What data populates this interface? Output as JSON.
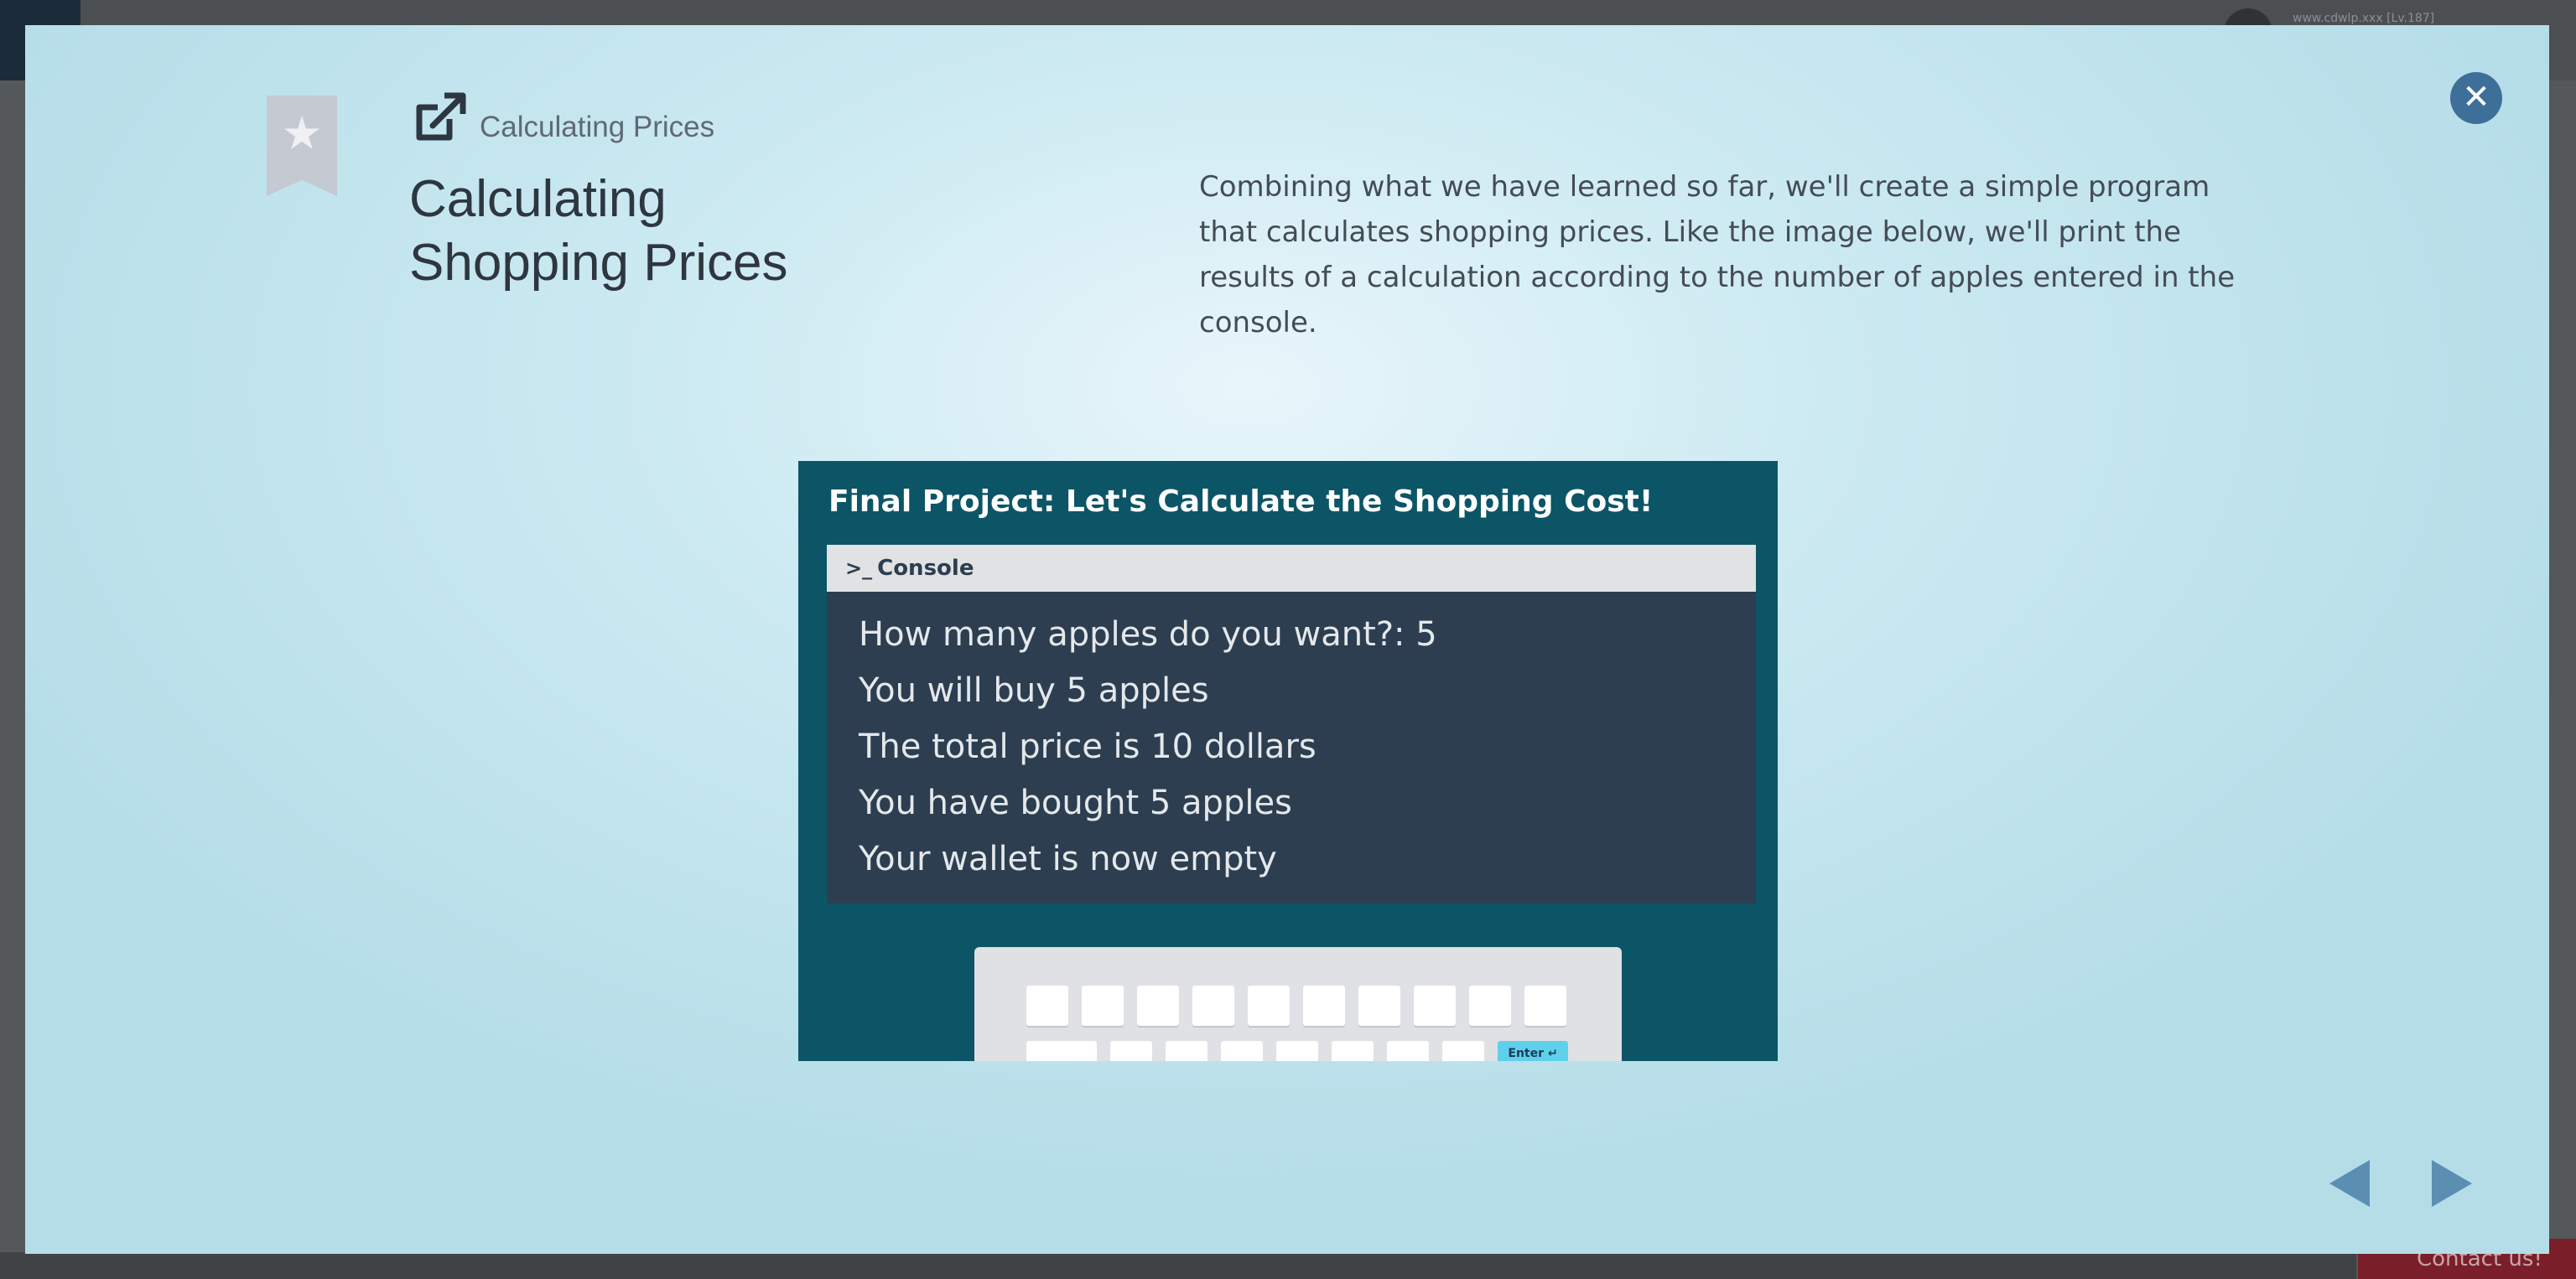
{
  "background": {
    "account_email": "www.cdwlp.xxx [Lv.187]",
    "contact_label": "Contact us!"
  },
  "lesson": {
    "breadcrumb": "Calculating Prices",
    "title": "Calculating Shopping Prices",
    "description": "Combining what we have learned so far, we'll create a simple program that calculates shopping prices. Like the image below, we'll print the results of a calculation according to the number of apples entered in the console."
  },
  "illustration": {
    "title": "Final Project: Let's Calculate the Shopping Cost!",
    "console_label": "Console",
    "console_lines": [
      "How many apples do you want?: 5",
      "You will buy 5 apples",
      "The total price is 10 dollars",
      "You have bought 5 apples",
      "Your wallet is now empty"
    ],
    "enter_key_label": "Enter ↵"
  },
  "icons": {
    "close": "close-icon",
    "external_link": "external-link-icon",
    "bookmark": "bookmark-star-icon",
    "prev": "arrow-left-icon",
    "next": "arrow-right-icon"
  },
  "colors": {
    "close_button": "#3e6f99",
    "nav_arrows": "#5b8fb2",
    "illustration_bg": "#0c5567",
    "console_bg": "#2c3e50",
    "enter_key": "#5fd0ec"
  }
}
